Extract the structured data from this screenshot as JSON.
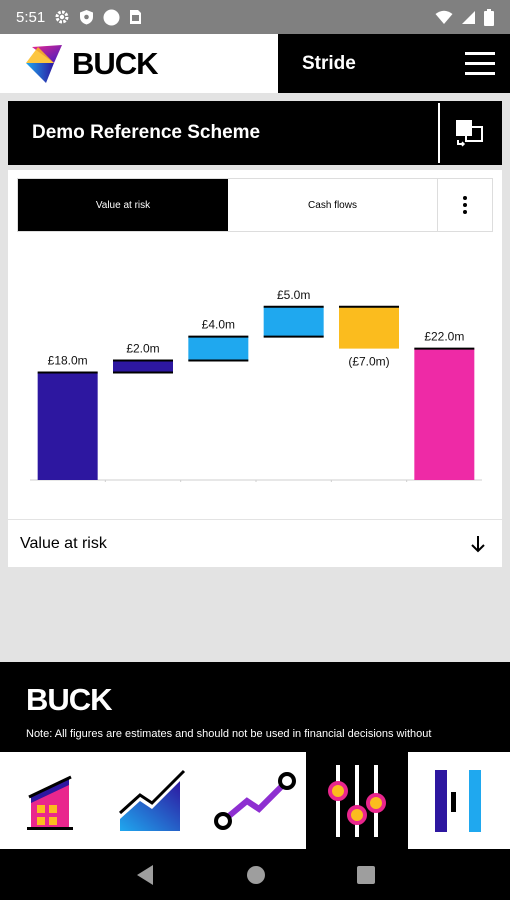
{
  "status_bar": {
    "time": "5:51",
    "icons": [
      "gear-icon",
      "shield-icon",
      "circle-icon",
      "sim-card-icon",
      "wifi-icon",
      "signal-icon",
      "battery-icon"
    ]
  },
  "header": {
    "logo_text": "BUCK",
    "product_name": "Stride",
    "menu_icon": "hamburger-icon"
  },
  "scheme": {
    "title": "Demo Reference Scheme",
    "switch_icon": "switch-scheme-icon"
  },
  "tabs": {
    "active_label": "Value at risk",
    "inactive_label": "Cash flows",
    "more_icon": "more-vertical-icon"
  },
  "chart_data": {
    "type": "waterfall",
    "title": "",
    "categories": [
      "",
      "",
      "",
      "",
      "",
      ""
    ],
    "values": [
      18.0,
      2.0,
      4.0,
      5.0,
      -7.0,
      22.0
    ],
    "labels": [
      "£18.0m",
      "£2.0m",
      "£4.0m",
      "£5.0m",
      "(£7.0m)",
      "£22.0m"
    ],
    "kinds": [
      "total",
      "delta",
      "delta",
      "delta",
      "delta",
      "total"
    ],
    "colors": [
      "#2d17a0",
      "#2d17a0",
      "#1fa8ef",
      "#1fa8ef",
      "#fbbc1e",
      "#ee2aa6"
    ],
    "ylim": [
      0,
      36
    ]
  },
  "accordion": {
    "label": "Value at risk",
    "icon": "arrow-down-icon"
  },
  "footer": {
    "logo_text": "BUCK",
    "note": "Note: All figures are estimates and should not be used in financial decisions without"
  },
  "bottom_nav": [
    {
      "icon": "building-icon",
      "active": false
    },
    {
      "icon": "growth-chart-icon",
      "active": false
    },
    {
      "icon": "journey-path-icon",
      "active": false
    },
    {
      "icon": "sliders-icon",
      "active": true
    },
    {
      "icon": "bar-compare-icon",
      "active": false
    }
  ],
  "system_nav": [
    "back-icon",
    "home-icon",
    "recents-icon"
  ]
}
